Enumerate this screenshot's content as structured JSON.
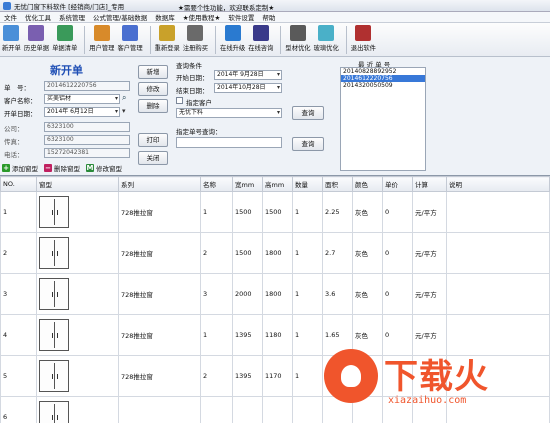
{
  "window": {
    "title": "无忧门窗下料软件 [经销商/门店]_专用",
    "center_text": "★需要个性功能，欢迎联系定制★"
  },
  "menu": [
    "文件",
    "优化工具",
    "系统管理",
    "公式管理/基础数据",
    "数据库",
    "★使用教程★",
    "软件设置",
    "帮助"
  ],
  "toolbar": [
    {
      "label": "新开单",
      "icon": "new-order-icon",
      "color": "#4a8fd8"
    },
    {
      "label": "历史单据",
      "icon": "history-icon",
      "color": "#7a5fb0"
    },
    {
      "label": "单据清单",
      "icon": "list-icon",
      "color": "#3a9a5a"
    },
    {
      "label": "用户管理",
      "icon": "users-icon",
      "color": "#d88a2a"
    },
    {
      "label": "客户管理",
      "icon": "customers-icon",
      "color": "#4a6fd0"
    },
    {
      "label": "重新登录",
      "icon": "key-icon",
      "color": "#c9a12a"
    },
    {
      "label": "注册购买",
      "icon": "register-icon",
      "color": "#6a6a6a"
    },
    {
      "label": "在线升级",
      "icon": "upgrade-icon",
      "color": "#2a7ad0"
    },
    {
      "label": "在线咨询",
      "icon": "consult-icon",
      "color": "#3a3a8a"
    },
    {
      "label": "型材优化",
      "icon": "profile-icon",
      "color": "#5a5a5a"
    },
    {
      "label": "玻璃优化",
      "icon": "glass-icon",
      "color": "#4ab0c8"
    },
    {
      "label": "退出软件",
      "icon": "exit-icon",
      "color": "#b03030"
    }
  ],
  "form": {
    "heading": "新开单",
    "order_no_label": "单　号：",
    "order_no": "2014612220756",
    "customer_label": "客户名称：",
    "customer": "买美铝材",
    "date_label": "开单日期：",
    "date": "2014年 6月12日",
    "company_label": "公司：",
    "company": "6323100",
    "fax_label": "传真：",
    "fax": "6323100",
    "phone_label": "电话：",
    "phone": "15272042381",
    "btn_new": "新增",
    "btn_edit": "修改",
    "btn_delete": "删除",
    "btn_print": "打印",
    "btn_close": "关闭"
  },
  "query": {
    "heading": "查询条件",
    "start_label": "开始日期：",
    "start_date": "2014年 9月28日",
    "end_label": "结束日期：",
    "end_date": "2014年10月28日",
    "customer_check_label": "指定客户",
    "customer_value": "无忧下料",
    "btn_query": "查询",
    "order_query_label": "指定单号查询：",
    "btn_query2": "查询"
  },
  "recent": {
    "heading": "最 近 单 号",
    "items": [
      "2014082889295​2",
      "2014612220756",
      "2014320050509"
    ],
    "selected_index": 1
  },
  "minibar": [
    {
      "label": "添加窗型",
      "symbol": "+",
      "color": "#2a9a2a"
    },
    {
      "label": "删除窗型",
      "symbol": "−",
      "color": "#c02060"
    },
    {
      "label": "修改窗型",
      "symbol": "M",
      "color": "#2a8a3a"
    }
  ],
  "table": {
    "headers": [
      "NO.",
      "窗型",
      "系列",
      "名称",
      "宽mm",
      "高mm",
      "数量",
      "面积",
      "颜色",
      "单价",
      "计算",
      "说明"
    ],
    "rows": [
      [
        "1",
        "",
        "728推拉窗",
        "1",
        "1500",
        "1500",
        "1",
        "2.25",
        "灰色",
        "0",
        "元/平方",
        ""
      ],
      [
        "2",
        "",
        "728推拉窗",
        "2",
        "1500",
        "1800",
        "1",
        "2.7",
        "灰色",
        "0",
        "元/平方",
        ""
      ],
      [
        "3",
        "",
        "728推拉窗",
        "3",
        "2000",
        "1800",
        "1",
        "3.6",
        "灰色",
        "0",
        "元/平方",
        ""
      ],
      [
        "4",
        "",
        "728推拉窗",
        "1",
        "1395",
        "1180",
        "1",
        "1.65",
        "灰色",
        "0",
        "元/平方",
        ""
      ],
      [
        "5",
        "",
        "728推拉窗",
        "2",
        "1395",
        "1170",
        "1",
        "",
        "",
        "",
        "",
        ""
      ],
      [
        "6",
        "",
        "",
        "",
        "",
        "",
        "",
        "",
        "",
        "",
        "",
        ""
      ]
    ]
  },
  "watermark": {
    "big": "下载火",
    "small": "xiazaihuo.com"
  }
}
